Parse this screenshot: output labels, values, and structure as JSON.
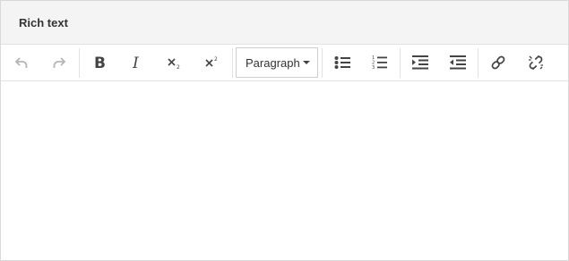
{
  "editor": {
    "title": "Rich text"
  },
  "toolbar": {
    "block_format": {
      "selected": "Paragraph"
    },
    "buttons": [
      {
        "name": "undo",
        "icon": "undo-icon",
        "state": "disabled"
      },
      {
        "name": "redo",
        "icon": "redo-icon",
        "state": "disabled"
      },
      {
        "name": "bold",
        "icon": "bold-icon"
      },
      {
        "name": "italic",
        "icon": "italic-icon"
      },
      {
        "name": "subscript",
        "icon": "subscript-icon"
      },
      {
        "name": "superscript",
        "icon": "superscript-icon"
      },
      {
        "name": "bullet-list",
        "icon": "bullet-list-icon"
      },
      {
        "name": "numbered-list",
        "icon": "numbered-list-icon"
      },
      {
        "name": "indent",
        "icon": "indent-icon"
      },
      {
        "name": "outdent",
        "icon": "outdent-icon"
      },
      {
        "name": "link",
        "icon": "link-icon"
      },
      {
        "name": "unlink",
        "icon": "unlink-icon"
      }
    ]
  },
  "content": {
    "text": ""
  },
  "colors": {
    "header_bg": "#f4f4f4",
    "icon": "#444444",
    "icon_disabled": "#b5b5b5",
    "border": "#d9d9d9"
  }
}
